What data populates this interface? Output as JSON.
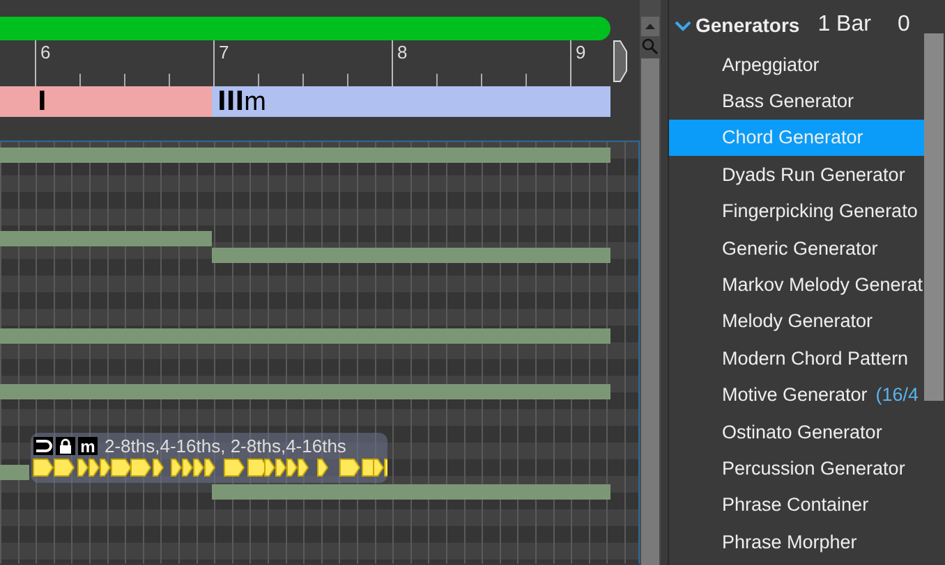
{
  "timeline": {
    "ruler": [
      {
        "label": "6"
      },
      {
        "label": "7"
      },
      {
        "label": "8"
      },
      {
        "label": "9"
      }
    ],
    "chords": [
      {
        "numeral": "I",
        "color": "#f0a6a6"
      },
      {
        "numeral": "III",
        "suffix": "m",
        "color": "#b0c0f0"
      }
    ]
  },
  "pattern": {
    "badge": "m",
    "label": "2-8ths,4-16ths, 2-8ths,4-16ths"
  },
  "browser": {
    "group": {
      "label": "Generators",
      "expanded": true,
      "length": "1 Bar",
      "column_3": "0"
    },
    "items": [
      {
        "label": "Arpeggiator",
        "selected": false
      },
      {
        "label": "Bass Generator",
        "selected": false
      },
      {
        "label": "Chord Generator",
        "selected": true
      },
      {
        "label": "Dyads Run Generator",
        "selected": false
      },
      {
        "label": "Fingerpicking Generato",
        "selected": false
      },
      {
        "label": "Generic Generator",
        "selected": false
      },
      {
        "label": "Markov Melody Generat",
        "selected": false
      },
      {
        "label": "Melody Generator",
        "selected": false
      },
      {
        "label": "Modern Chord Pattern",
        "selected": false
      },
      {
        "label": "Motive Generator",
        "count": "(16/4",
        "selected": false
      },
      {
        "label": "Ostinato Generator",
        "selected": false
      },
      {
        "label": "Percussion Generator",
        "selected": false
      },
      {
        "label": "Phrase Container",
        "selected": false
      },
      {
        "label": "Phrase Morpher",
        "selected": false
      }
    ]
  }
}
